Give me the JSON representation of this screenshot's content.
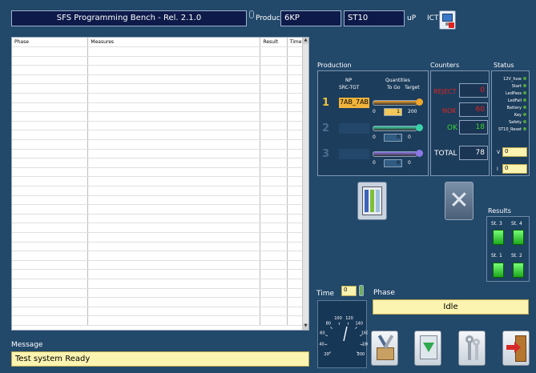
{
  "header": {
    "title": "SFS Programming Bench - Rel. 2.1.0",
    "product_label": "Product",
    "product_value": "6KP",
    "uP_value": "ST10",
    "uP_label": "uP",
    "ict_label": "ICT"
  },
  "table": {
    "columns": [
      "Phase",
      "Measures",
      "Result",
      "Time"
    ],
    "rows": []
  },
  "production": {
    "title": "Production",
    "np_label": "NP",
    "src_tgt_label": "SRC-TGT",
    "quantities_label": "Quantities",
    "togo_label": "To Go",
    "target_label": "Target",
    "lines": [
      {
        "num": "1",
        "code": "7AB_7AB",
        "togo": "0",
        "current": "1",
        "target": "200",
        "color": "#f0a52b"
      },
      {
        "num": "2",
        "code": "",
        "togo": "0",
        "current": "0",
        "target": "0",
        "color": "#3bd1a8"
      },
      {
        "num": "3",
        "code": "",
        "togo": "0",
        "current": "0",
        "target": "0",
        "color": "#8d77e6"
      }
    ]
  },
  "counters": {
    "title": "Counters",
    "reject_label": "REJECT",
    "reject_value": "0",
    "nok_label": "NOK",
    "nok_value": "60",
    "ok_label": "OK",
    "ok_value": "18",
    "total_label": "TOTAL",
    "total_value": "78"
  },
  "status": {
    "title": "Status",
    "items": [
      "12V_fuse",
      "Start",
      "LedPass",
      "LedFail",
      "Battery",
      "Key",
      "Safety",
      "ST10_Reset"
    ],
    "v_label": "V",
    "v_value": "0",
    "i_label": "I",
    "i_value": "0"
  },
  "results": {
    "title": "Results",
    "stations": [
      "St. 3",
      "St. 4",
      "St. 1",
      "St. 2"
    ]
  },
  "time": {
    "label": "Time",
    "value": "0",
    "gauge_ticks": [
      "20",
      "40",
      "60",
      "80",
      "100",
      "120",
      "140",
      "160",
      "180",
      "200"
    ]
  },
  "phase": {
    "label": "Phase",
    "value": "Idle"
  },
  "message": {
    "label": "Message",
    "value": "Test system Ready"
  },
  "toolbar": {
    "icons": [
      "tools-icon",
      "download-icon",
      "keys-icon",
      "exit-icon"
    ]
  }
}
